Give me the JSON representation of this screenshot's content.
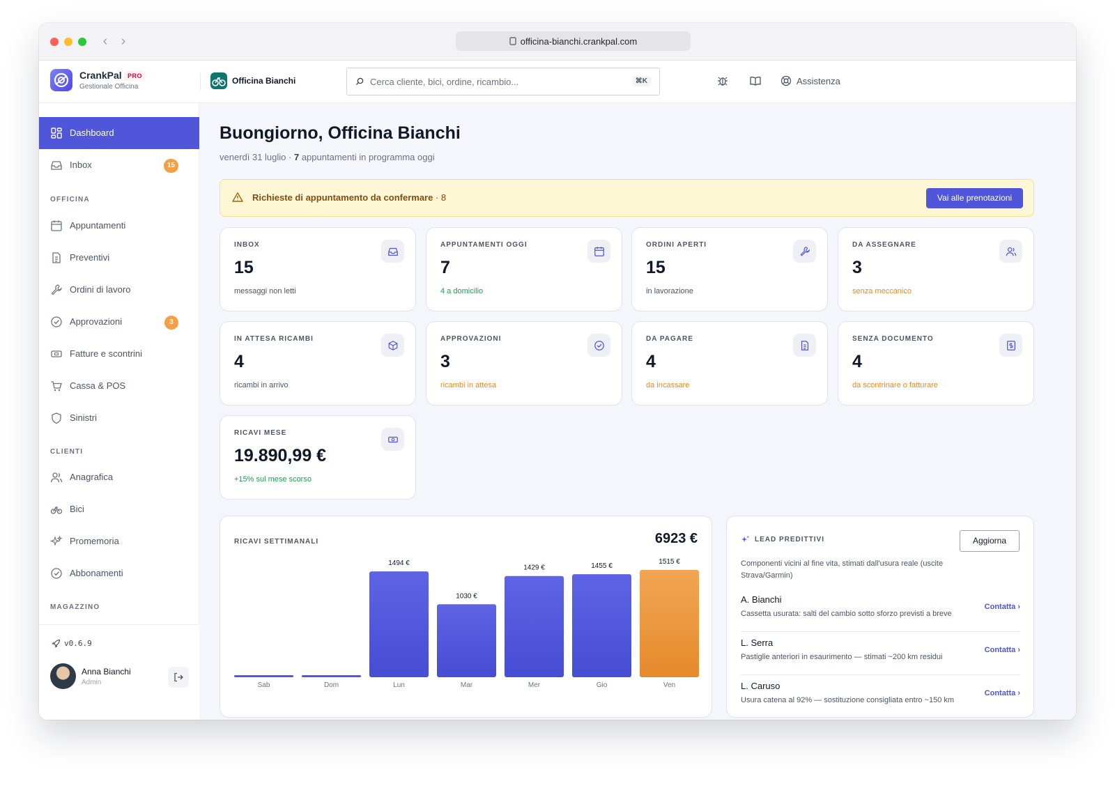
{
  "browser": {
    "url": "officina-bianchi.crankpal.com"
  },
  "brand": {
    "name": "CrankPal",
    "badge": "PRO",
    "subtitle": "Gestionale Officina"
  },
  "shop": {
    "name": "Officina Bianchi"
  },
  "search": {
    "placeholder": "Cerca cliente, bici, ordine, ricambio...",
    "shortcut": "⌘K"
  },
  "header": {
    "assist_label": "Assistenza"
  },
  "sidebar": {
    "dashboard": "Dashboard",
    "inbox": {
      "label": "Inbox",
      "badge": "15"
    },
    "sec_officina": "OFFICINA",
    "appuntamenti": "Appuntamenti",
    "preventivi": "Preventivi",
    "ordini": "Ordini di lavoro",
    "approvazioni": {
      "label": "Approvazioni",
      "badge": "3"
    },
    "fatture": "Fatture e scontrini",
    "cassa": "Cassa & POS",
    "sinistri": "Sinistri",
    "sec_clienti": "CLIENTI",
    "anagrafica": "Anagrafica",
    "bici": "Bici",
    "promemoria": "Promemoria",
    "abbonamenti": "Abbonamenti",
    "sec_magazzino": "MAGAZZINO",
    "version": "v0.6.9",
    "user": {
      "name": "Anna Bianchi",
      "role": "Admin"
    }
  },
  "main": {
    "greeting": "Buongiorno, Officina Bianchi",
    "date": "venerdì 31 luglio",
    "appt_count": "7",
    "appt_text": "appuntamenti in programma oggi",
    "alert": {
      "text": "Richieste di appuntamento da confermare",
      "count": "· 8",
      "button": "Vai alle prenotazioni"
    },
    "cards": [
      {
        "title": "INBOX",
        "value": "15",
        "sub": "messaggi non letti",
        "sub_color": "#4b5563"
      },
      {
        "title": "APPUNTAMENTI OGGI",
        "value": "7",
        "sub": "4 a domicilio",
        "sub_color": "#16a34a"
      },
      {
        "title": "ORDINI APERTI",
        "value": "15",
        "sub": "in lavorazione",
        "sub_color": "#4b5563"
      },
      {
        "title": "DA ASSEGNARE",
        "value": "3",
        "sub": "senza meccanico",
        "sub_color": "#ea8a1a"
      },
      {
        "title": "IN ATTESA RICAMBI",
        "value": "4",
        "sub": "ricambi in arrivo",
        "sub_color": "#4b5563"
      },
      {
        "title": "APPROVAZIONI",
        "value": "3",
        "sub": "ricambi in attesa",
        "sub_color": "#ea8a1a"
      },
      {
        "title": "DA PAGARE",
        "value": "4",
        "sub": "da incassare",
        "sub_color": "#ea8a1a"
      },
      {
        "title": "SENZA DOCUMENTO",
        "value": "4",
        "sub": "da scontrinare o fatturare",
        "sub_color": "#ea8a1a"
      },
      {
        "title": "RICAVI MESE",
        "value": "19.890,99 €",
        "sub": "+15% sul mese scorso",
        "sub_color": "#16a34a"
      }
    ],
    "leads": {
      "title": "LEAD PREDITTIVI",
      "refresh": "Aggiorna",
      "desc": "Componenti vicini al fine vita, stimati dall'usura reale (uscite Strava/Garmin)",
      "items": [
        {
          "name": "A. Bianchi",
          "note": "Cassetta usurata: salti del cambio sotto sforzo previsti a breve",
          "action": "Contatta ›"
        },
        {
          "name": "L. Serra",
          "note": "Pastiglie anteriori in esaurimento — stimati ~200 km residui",
          "action": "Contatta ›"
        },
        {
          "name": "L. Caruso",
          "note": "Usura catena al 92% — sostituzione consigliata entro ~150 km",
          "action": "Contatta ›"
        }
      ]
    }
  },
  "chart_data": {
    "type": "bar",
    "title": "RICAVI SETTIMANALI",
    "total": "6923 €",
    "categories": [
      "Sab",
      "Dom",
      "Lun",
      "Mar",
      "Mer",
      "Gio",
      "Ven"
    ],
    "values": [
      0,
      0,
      1494,
      1030,
      1429,
      1455,
      1515
    ],
    "value_labels": [
      "",
      "",
      "1494 €",
      "1030 €",
      "1429 €",
      "1455 €",
      "1515 €"
    ],
    "highlight_index": 6,
    "colors": {
      "bar": "#5158dd",
      "highlight": "#ee9a3c"
    },
    "ylim": [
      0,
      1515
    ],
    "grid": false
  }
}
